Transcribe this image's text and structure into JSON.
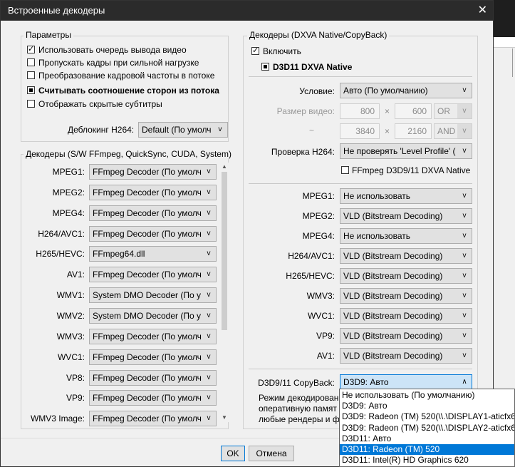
{
  "window": {
    "title": "Встроенные декодеры",
    "close": "✕"
  },
  "params": {
    "title": "Параметры",
    "items": [
      {
        "label": "Использовать очередь вывода видео",
        "state": "checked"
      },
      {
        "label": "Пропускать кадры при сильной нагрузке",
        "state": "unchecked"
      },
      {
        "label": "Преобразование кадровой частоты в потоке",
        "state": "unchecked"
      },
      {
        "label": "Считывать соотношение сторон из потока",
        "state": "indeterminate"
      },
      {
        "label": "Отображать скрытые субтитры",
        "state": "unchecked"
      }
    ],
    "deblock_label": "Деблокинг H264:",
    "deblock_value": "Default (По умолч"
  },
  "sw_decoders": {
    "title": "Декодеры (S/W FFmpeg, QuickSync, CUDA, System)",
    "rows": [
      {
        "label": "MPEG1:",
        "value": "FFmpeg Decoder (По умолч"
      },
      {
        "label": "MPEG2:",
        "value": "FFmpeg Decoder (По умолч"
      },
      {
        "label": "MPEG4:",
        "value": "FFmpeg Decoder (По умолч"
      },
      {
        "label": "H264/AVC1:",
        "value": "FFmpeg Decoder (По умолч"
      },
      {
        "label": "H265/HEVC:",
        "value": "FFmpeg64.dll"
      },
      {
        "label": "AV1:",
        "value": "FFmpeg Decoder (По умолч"
      },
      {
        "label": "WMV1:",
        "value": "System DMO Decoder (По у"
      },
      {
        "label": "WMV2:",
        "value": "System DMO Decoder (По у"
      },
      {
        "label": "WMV3:",
        "value": "FFmpeg Decoder (По умолч"
      },
      {
        "label": "WVC1:",
        "value": "FFmpeg Decoder (По умолч"
      },
      {
        "label": "VP8:",
        "value": "FFmpeg Decoder (По умолч"
      },
      {
        "label": "VP9:",
        "value": "FFmpeg Decoder (По умолч"
      },
      {
        "label": "WMV3 Image:",
        "value": "FFmpeg Decoder (По умолч"
      }
    ]
  },
  "dxva": {
    "title": "Декодеры (DXVA Native/CopyBack)",
    "enable_label": "Включить",
    "mode_label": "D3D11 DXVA Native",
    "condition_label": "Условие:",
    "condition_value": "Авто (По умолчанию)",
    "video_size_label": "Размер видео:",
    "size1_w": "800",
    "size1_h": "600",
    "size1_op": "OR",
    "size2_prefix": "~",
    "size2_w": "3840",
    "size2_h": "2160",
    "size2_op": "AND",
    "times": "×",
    "h264_check_label": "Проверка H264:",
    "h264_check_value": "Не проверять 'Level Profile' (",
    "ffmpeg_native_label": "FFmpeg D3D9/11 DXVA Native",
    "rows": [
      {
        "label": "MPEG1:",
        "value": "Не использовать"
      },
      {
        "label": "MPEG2:",
        "value": "VLD (Bitstream Decoding)"
      },
      {
        "label": "MPEG4:",
        "value": "Не использовать"
      },
      {
        "label": "H264/AVC1:",
        "value": "VLD (Bitstream Decoding)"
      },
      {
        "label": "H265/HEVC:",
        "value": "VLD (Bitstream Decoding)"
      },
      {
        "label": "WMV3:",
        "value": "VLD (Bitstream Decoding)"
      },
      {
        "label": "WVC1:",
        "value": "VLD (Bitstream Decoding)"
      },
      {
        "label": "VP9:",
        "value": "VLD (Bitstream Decoding)"
      },
      {
        "label": "AV1:",
        "value": "VLD (Bitstream Decoding)"
      }
    ],
    "copyback_label": "D3D9/11 CopyBack:",
    "copyback_value": "D3D9: Авто",
    "desc_lines": [
      "Режим декодировани",
      "оперативную памят",
      "любые рендеры и фи"
    ]
  },
  "dropdown_options": [
    "Не использовать (По умолчанию)",
    "D3D9: Авто",
    "D3D9: Radeon (TM) 520(\\\\.\\DISPLAY1-aticfx64.",
    "D3D9: Radeon (TM) 520(\\\\.\\DISPLAY2-aticfx64.",
    "D3D11: Авто",
    "D3D11: Radeon (TM) 520",
    "D3D11: Intel(R) HD Graphics 620"
  ],
  "dropdown_selected_index": 5,
  "buttons": {
    "ok": "OK",
    "cancel": "Отмена"
  },
  "icons": {
    "arrow_down": "v",
    "arrow_up": "∧",
    "scroll_up": "▲",
    "scroll_down": "▼"
  }
}
